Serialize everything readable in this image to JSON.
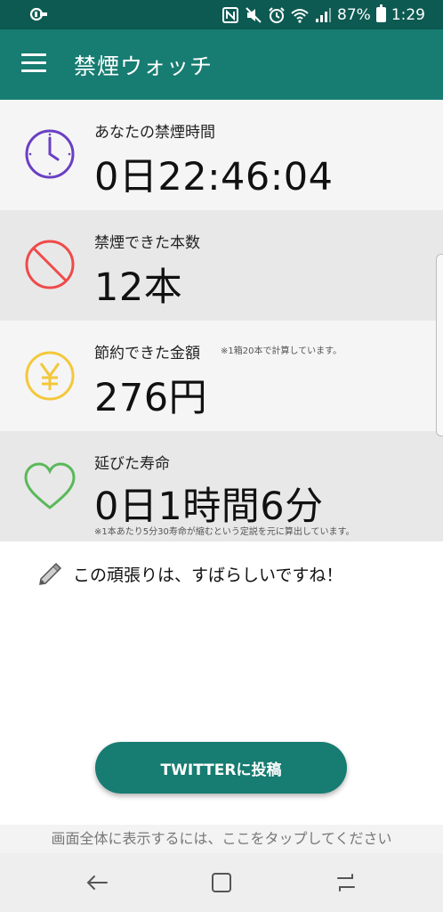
{
  "status_bar": {
    "battery_percent": "87%",
    "time": "1:29",
    "icons": [
      "nfc-icon",
      "mute-icon",
      "alarm-icon",
      "wifi-icon",
      "signal-icon",
      "battery-icon"
    ]
  },
  "app_bar": {
    "title": "禁煙ウォッチ",
    "menu_icon": "hamburger-icon"
  },
  "cards": {
    "time": {
      "label": "あなたの禁煙時間",
      "value": "0日22:46:04",
      "icon": "clock-icon",
      "icon_color": "#6a3fc4"
    },
    "count": {
      "label": "禁煙できた本数",
      "value": "12本",
      "icon": "prohibited-icon",
      "icon_color": "#f04a4a"
    },
    "money": {
      "label": "節約できた金額",
      "note": "※1箱20本で計算しています。",
      "value": "276円",
      "icon": "yen-icon",
      "icon_color": "#f3c83a"
    },
    "life": {
      "label": "延びた寿命",
      "value": "0日1時間6分",
      "note": "※1本あたり5分30寿命が縮むという定説を元に算出しています。",
      "icon": "heart-icon",
      "icon_color": "#5ab85a"
    }
  },
  "message": {
    "text": "この頑張りは、すばらしいですね！",
    "icon": "pencil-icon"
  },
  "twitter_button": {
    "label": "TWITTERに投稿"
  },
  "fullscreen_hint": "画面全体に表示するには、ここをタップしてください",
  "colors": {
    "status_bar": "#0d5a52",
    "primary": "#177c71"
  }
}
